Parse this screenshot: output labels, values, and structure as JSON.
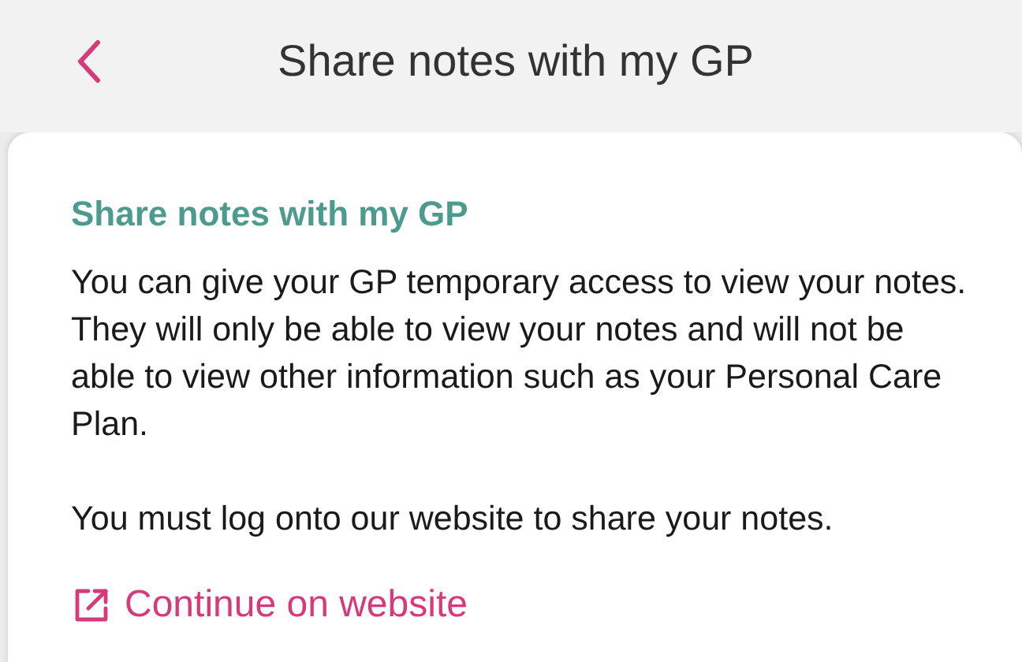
{
  "header": {
    "title": "Share notes with my GP"
  },
  "card": {
    "heading": "Share notes with my GP",
    "paragraphs": [
      "You can give your GP temporary access to view your notes. They will only be able to view your notes and will not be able to view other information such as your Personal Care Plan.",
      "You must log onto our website to share your notes."
    ],
    "link": "Continue on website"
  }
}
